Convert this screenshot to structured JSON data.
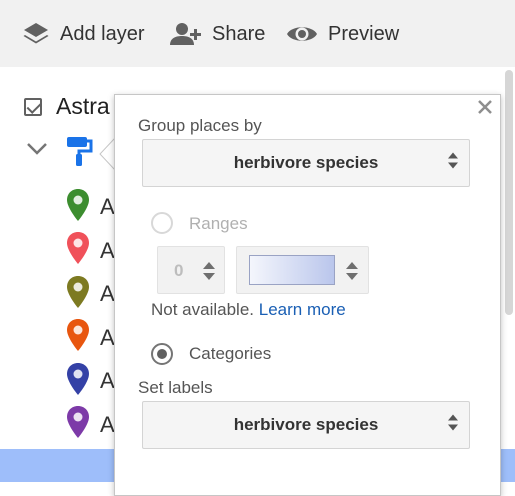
{
  "toolbar": {
    "add_layer_label": "Add layer",
    "share_label": "Share",
    "preview_label": "Preview"
  },
  "layer": {
    "name_visible": "Astra",
    "checked": true
  },
  "pins": [
    {
      "label": "A",
      "color": "#3c8d2f"
    },
    {
      "label": "A",
      "color": "#f0515a"
    },
    {
      "label": "A",
      "color": "#7d7a21"
    },
    {
      "label": "A",
      "color": "#e8560f"
    },
    {
      "label": "A",
      "color": "#3441a6"
    },
    {
      "label": "A",
      "color": "#7d3aa8"
    }
  ],
  "popup": {
    "group_label": "Group places by",
    "group_value": "herbivore species",
    "ranges_label": "Ranges",
    "ranges_selected": false,
    "range_count": "0",
    "not_available_text": "Not available.",
    "learn_more_link": "Learn more",
    "categories_label": "Categories",
    "categories_selected": true,
    "set_labels_label": "Set labels",
    "labels_value": "herbivore species"
  },
  "colors": {
    "accent_blue": "#1a73e8",
    "bottom_strip": "#9ebefa",
    "toolbar_bg": "#f1f1f1"
  }
}
